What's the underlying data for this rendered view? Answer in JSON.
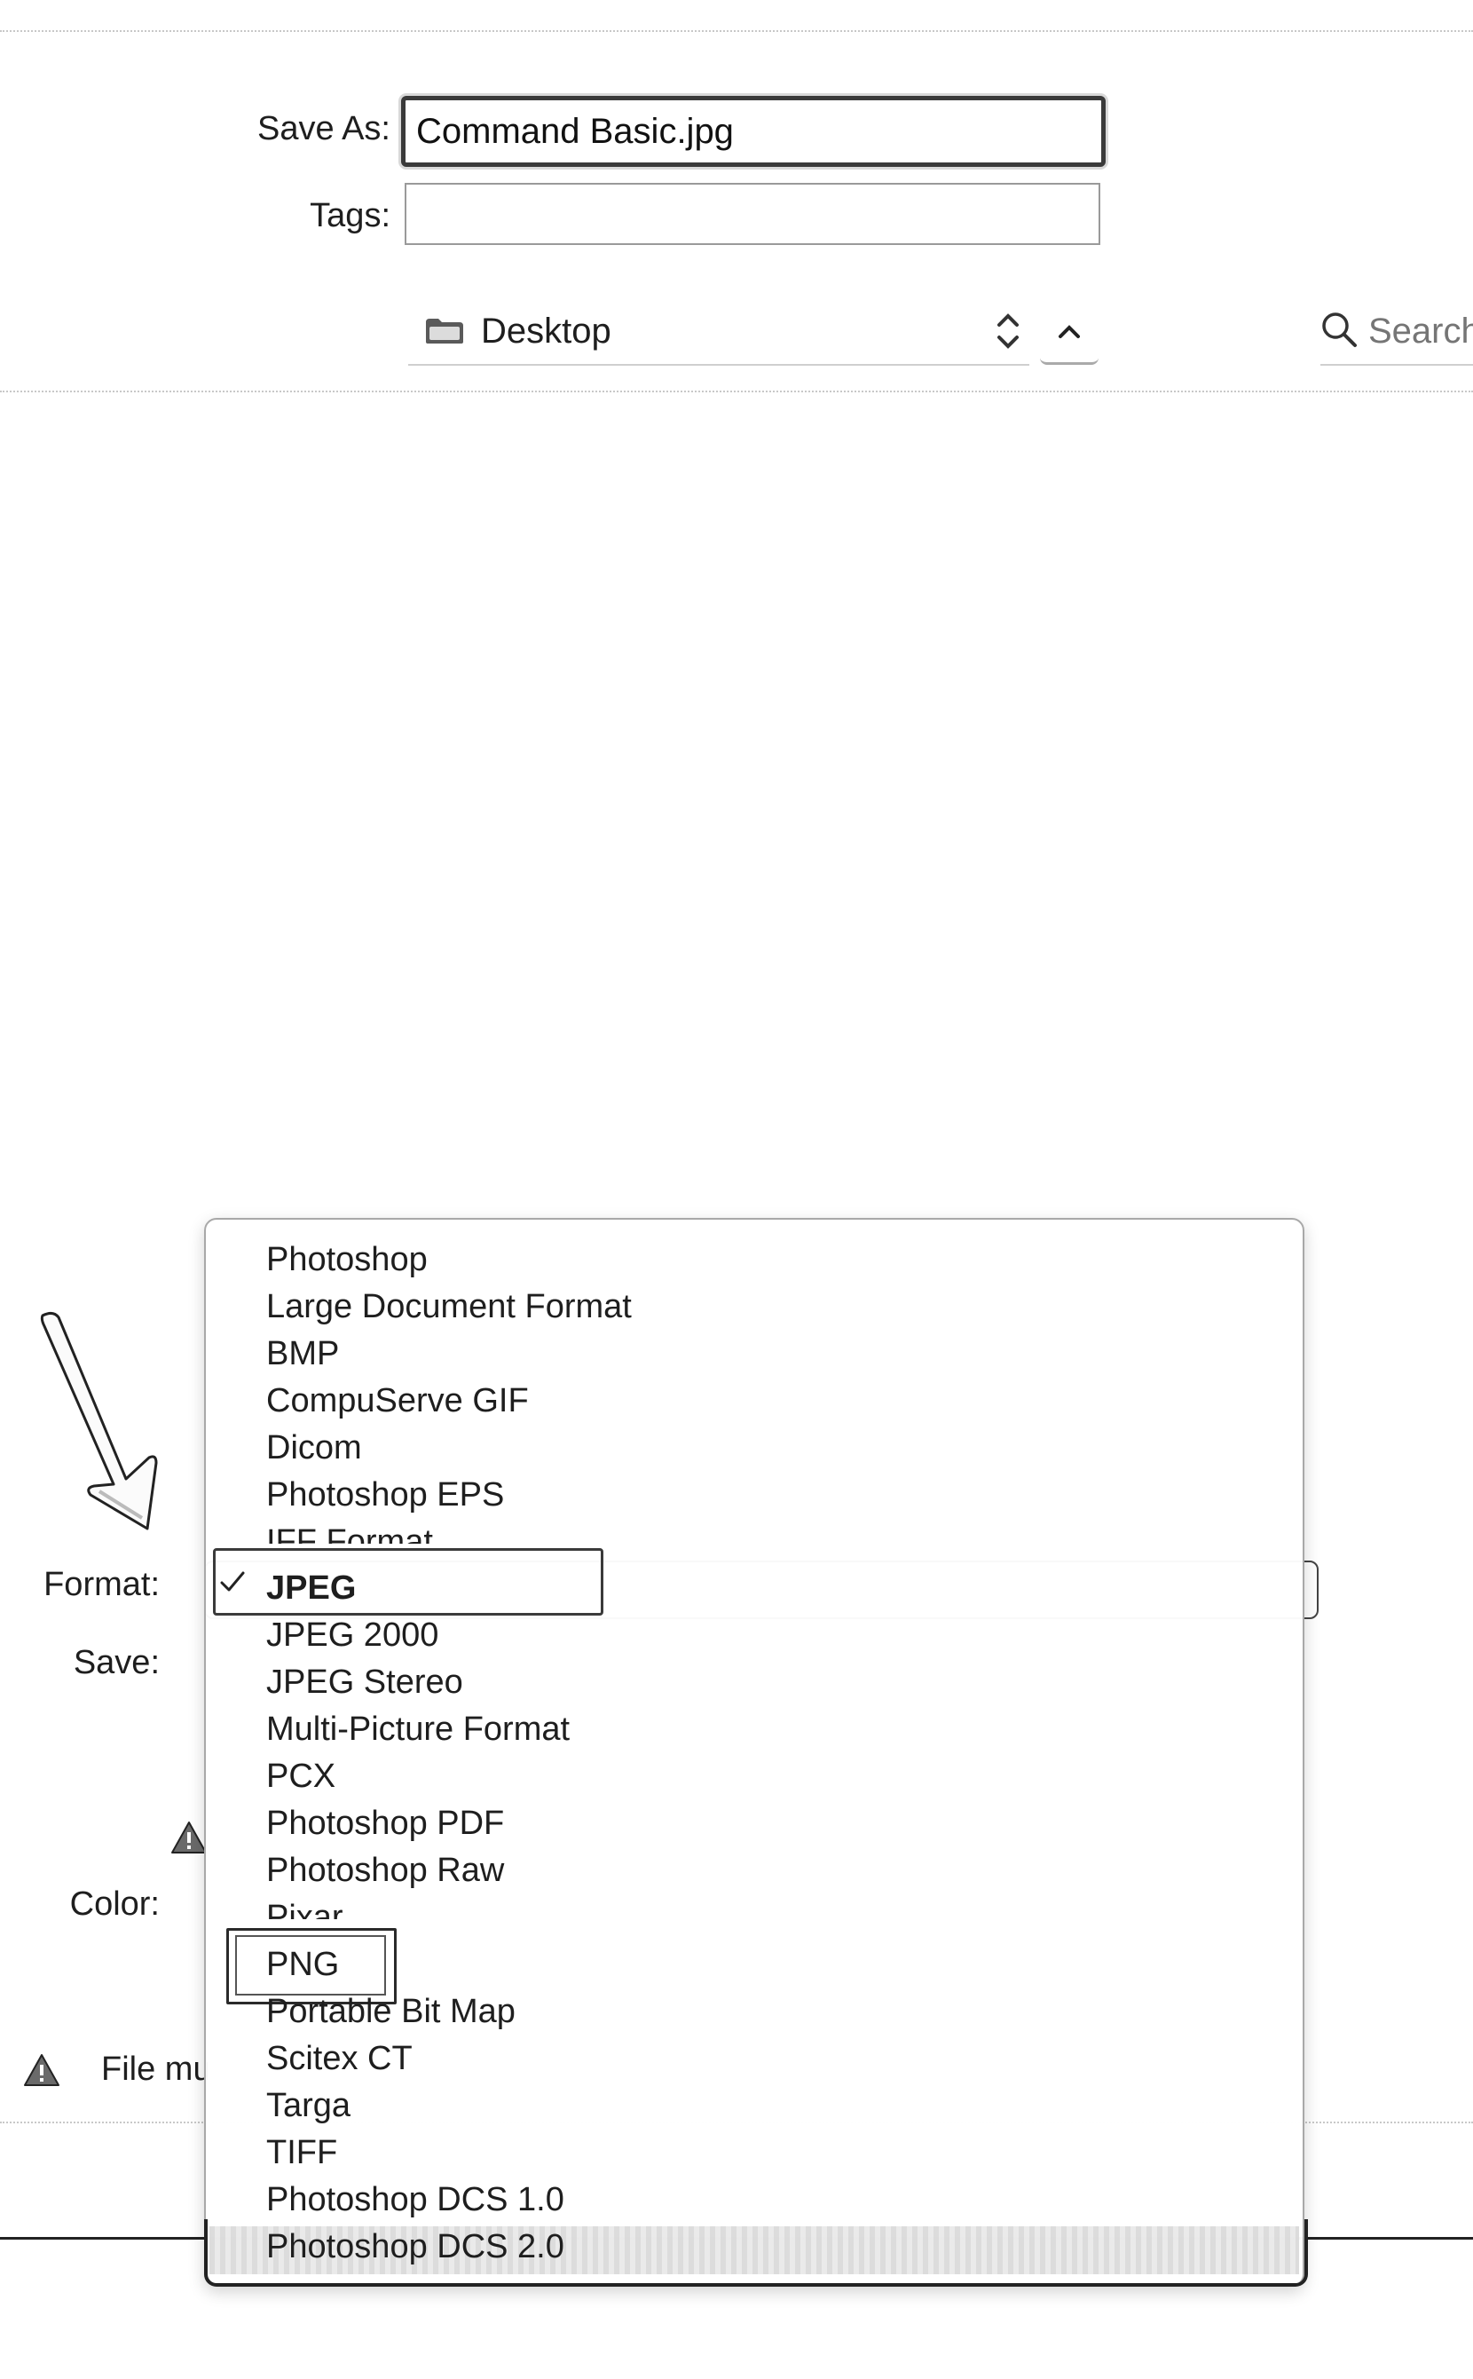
{
  "dialog": {
    "save_as_label": "Save As:",
    "save_as_value": "Command Basic.jpg",
    "tags_label": "Tags:",
    "tags_value": "",
    "location": "Desktop",
    "search_placeholder": "Search"
  },
  "options": {
    "format_label": "Format:",
    "save_label": "Save:",
    "color_label": "Color:",
    "file_warning": "File mu"
  },
  "format_menu": {
    "selected": "JPEG",
    "highlighted": "PNG",
    "items": [
      "Photoshop",
      "Large Document Format",
      "BMP",
      "CompuServe GIF",
      "Dicom",
      "Photoshop EPS",
      "IFF Format",
      "JPEG",
      "JPEG 2000",
      "JPEG Stereo",
      "Multi-Picture Format",
      "PCX",
      "Photoshop PDF",
      "Photoshop Raw",
      "Pixar",
      "PNG",
      "Portable Bit Map",
      "Scitex CT",
      "Targa",
      "TIFF",
      "Photoshop DCS 1.0",
      "Photoshop DCS 2.0"
    ]
  },
  "colors": {
    "border_dark": "#2a2a2a",
    "menu_border": "#a8a8a8",
    "warning": "#4a4a4a"
  }
}
